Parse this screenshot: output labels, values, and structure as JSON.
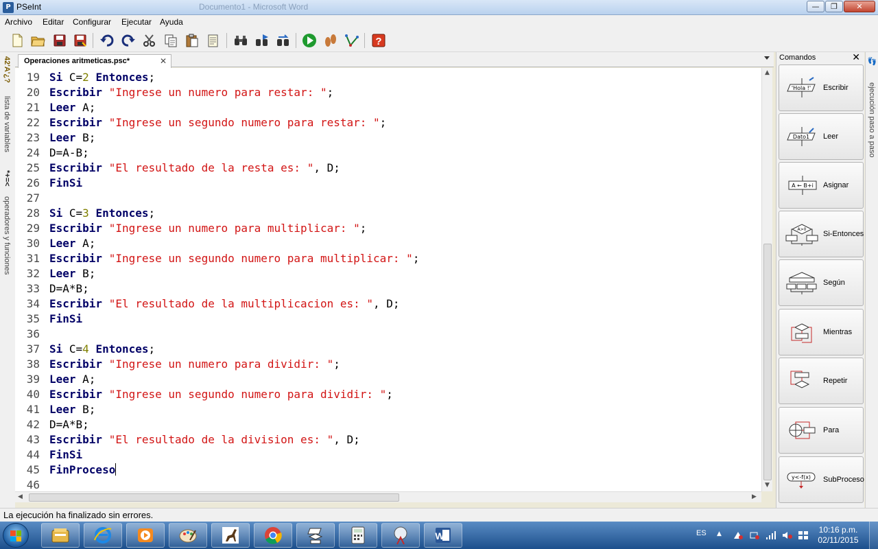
{
  "window": {
    "title": "PSeInt",
    "ghost_title": "Documento1 - Microsoft Word",
    "minimize_label": "—",
    "maximize_label": "❐",
    "close_label": "✕"
  },
  "menu": {
    "items": [
      "Archivo",
      "Editar",
      "Configurar",
      "Ejecutar",
      "Ayuda"
    ]
  },
  "toolbar": {
    "icons": [
      "new-file-icon",
      "open-folder-icon",
      "save-icon",
      "save-as-icon",
      "undo-icon",
      "redo-icon",
      "cut-icon",
      "copy-icon",
      "paste-icon",
      "edit-text-icon",
      "find-icon",
      "find-next-icon",
      "replace-icon",
      "run-icon",
      "step-by-step-icon",
      "flowchart-icon",
      "help-icon"
    ]
  },
  "left_panel": {
    "variables_label": "lista de variables",
    "variables_glyphs": "*+=<",
    "operators_label": "operadores y funciones",
    "operators_glyphs": "42'A'¿?"
  },
  "editor": {
    "tab_label": "Operaciones aritmeticas.psc*",
    "tab_close": "✕",
    "lines": [
      {
        "n": "19",
        "t": [
          [
            "kw",
            "Si"
          ],
          [
            "id",
            " C="
          ],
          [
            "num",
            "2"
          ],
          [
            "id",
            " "
          ],
          [
            "kw",
            "Entonces"
          ],
          [
            "id",
            ";"
          ]
        ]
      },
      {
        "n": "20",
        "t": [
          [
            "kw",
            "Escribir"
          ],
          [
            "id",
            " "
          ],
          [
            "str",
            "\"Ingrese un numero para restar: \""
          ],
          [
            "id",
            ";"
          ]
        ]
      },
      {
        "n": "21",
        "t": [
          [
            "kw",
            "Leer"
          ],
          [
            "id",
            " A;"
          ]
        ]
      },
      {
        "n": "22",
        "t": [
          [
            "kw",
            "Escribir"
          ],
          [
            "id",
            " "
          ],
          [
            "str",
            "\"Ingrese un segundo numero para restar: \""
          ],
          [
            "id",
            ";"
          ]
        ]
      },
      {
        "n": "23",
        "t": [
          [
            "kw",
            "Leer"
          ],
          [
            "id",
            " B;"
          ]
        ]
      },
      {
        "n": "24",
        "t": [
          [
            "id",
            "D=A-B;"
          ]
        ]
      },
      {
        "n": "25",
        "t": [
          [
            "kw",
            "Escribir"
          ],
          [
            "id",
            " "
          ],
          [
            "str",
            "\"El resultado de la resta es: \""
          ],
          [
            "id",
            ", D;"
          ]
        ]
      },
      {
        "n": "26",
        "t": [
          [
            "kw",
            "FinSi"
          ]
        ]
      },
      {
        "n": "27",
        "t": []
      },
      {
        "n": "28",
        "t": [
          [
            "kw",
            "Si"
          ],
          [
            "id",
            " C="
          ],
          [
            "num",
            "3"
          ],
          [
            "id",
            " "
          ],
          [
            "kw",
            "Entonces"
          ],
          [
            "id",
            ";"
          ]
        ]
      },
      {
        "n": "29",
        "t": [
          [
            "kw",
            "Escribir"
          ],
          [
            "id",
            " "
          ],
          [
            "str",
            "\"Ingrese un numero para multiplicar: \""
          ],
          [
            "id",
            ";"
          ]
        ]
      },
      {
        "n": "30",
        "t": [
          [
            "kw",
            "Leer"
          ],
          [
            "id",
            " A;"
          ]
        ]
      },
      {
        "n": "31",
        "t": [
          [
            "kw",
            "Escribir"
          ],
          [
            "id",
            " "
          ],
          [
            "str",
            "\"Ingrese un segundo numero para multiplicar: \""
          ],
          [
            "id",
            ";"
          ]
        ]
      },
      {
        "n": "32",
        "t": [
          [
            "kw",
            "Leer"
          ],
          [
            "id",
            " B;"
          ]
        ]
      },
      {
        "n": "33",
        "t": [
          [
            "id",
            "D=A*B;"
          ]
        ]
      },
      {
        "n": "34",
        "t": [
          [
            "kw",
            "Escribir"
          ],
          [
            "id",
            " "
          ],
          [
            "str",
            "\"El resultado de la multiplicacion es: \""
          ],
          [
            "id",
            ", D;"
          ]
        ]
      },
      {
        "n": "35",
        "t": [
          [
            "kw",
            "FinSi"
          ]
        ]
      },
      {
        "n": "36",
        "t": []
      },
      {
        "n": "37",
        "t": [
          [
            "kw",
            "Si"
          ],
          [
            "id",
            " C="
          ],
          [
            "num",
            "4"
          ],
          [
            "id",
            " "
          ],
          [
            "kw",
            "Entonces"
          ],
          [
            "id",
            ";"
          ]
        ]
      },
      {
        "n": "38",
        "t": [
          [
            "kw",
            "Escribir"
          ],
          [
            "id",
            " "
          ],
          [
            "str",
            "\"Ingrese un numero para dividir: \""
          ],
          [
            "id",
            ";"
          ]
        ]
      },
      {
        "n": "39",
        "t": [
          [
            "kw",
            "Leer"
          ],
          [
            "id",
            " A;"
          ]
        ]
      },
      {
        "n": "40",
        "t": [
          [
            "kw",
            "Escribir"
          ],
          [
            "id",
            " "
          ],
          [
            "str",
            "\"Ingrese un segundo numero para dividir: \""
          ],
          [
            "id",
            ";"
          ]
        ]
      },
      {
        "n": "41",
        "t": [
          [
            "kw",
            "Leer"
          ],
          [
            "id",
            " B;"
          ]
        ]
      },
      {
        "n": "42",
        "t": [
          [
            "id",
            "D=A*B;"
          ]
        ]
      },
      {
        "n": "43",
        "t": [
          [
            "kw",
            "Escribir"
          ],
          [
            "id",
            " "
          ],
          [
            "str",
            "\"El resultado de la division es: \""
          ],
          [
            "id",
            ", D;"
          ]
        ]
      },
      {
        "n": "44",
        "t": [
          [
            "kw",
            "FinSi"
          ]
        ]
      },
      {
        "n": "45",
        "t": [
          [
            "kw",
            "FinProceso"
          ]
        ],
        "caret": true
      },
      {
        "n": "46",
        "t": []
      }
    ],
    "colors": {
      "keyword": "#000066",
      "string": "#d21414",
      "number": "#808000"
    }
  },
  "commands": {
    "header": "Comandos",
    "close": "✕",
    "items": [
      {
        "label": "Escribir",
        "diagram": "'Hola !'"
      },
      {
        "label": "Leer",
        "diagram": "Dato1"
      },
      {
        "label": "Asignar",
        "diagram": "A ← B+i"
      },
      {
        "label": "Si-Entonces",
        "diagram": "A>0"
      },
      {
        "label": "Según",
        "diagram": ""
      },
      {
        "label": "Mientras",
        "diagram": ""
      },
      {
        "label": "Repetir",
        "diagram": ""
      },
      {
        "label": "Para",
        "diagram": ""
      },
      {
        "label": "SubProceso",
        "diagram": "y<-f(x)"
      }
    ]
  },
  "right_panel": {
    "label": "ejecución paso a paso"
  },
  "status": {
    "message": "La ejecución ha finalizado sin errores."
  },
  "taskbar": {
    "apps": [
      "explorer-icon",
      "internet-explorer-icon",
      "media-player-icon",
      "paint-icon",
      "dinosaur-app-icon",
      "chrome-icon",
      "pseint-icon",
      "calculator-icon",
      "snipping-tool-icon",
      "word-icon"
    ],
    "language": "ES",
    "time": "10:16 p.m.",
    "date": "02/11/2015"
  }
}
